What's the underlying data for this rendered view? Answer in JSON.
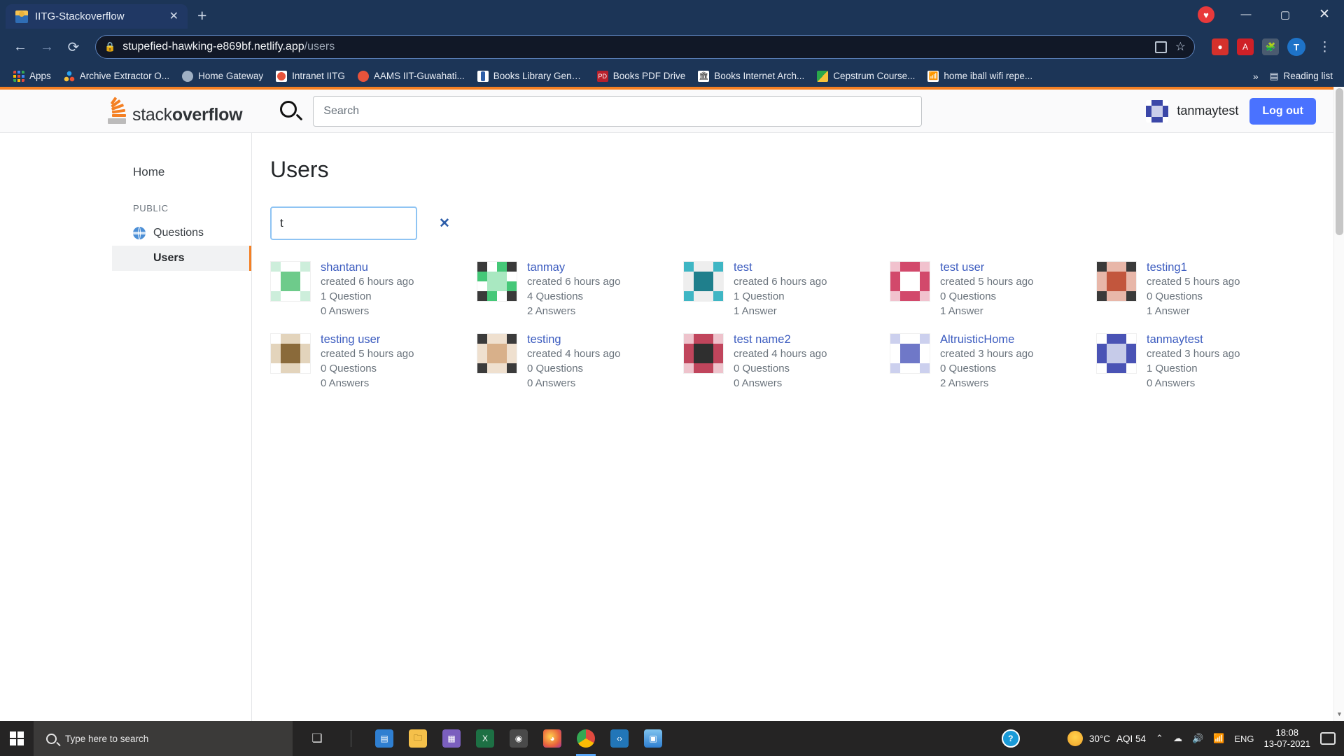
{
  "browser": {
    "tab": {
      "title": "IITG-Stackoverflow",
      "close": "✕",
      "new_tab": "+"
    },
    "window_controls": {
      "minimize": "—",
      "maximize": "▢",
      "close": "✕"
    },
    "nav": {
      "back": "←",
      "forward": "→",
      "reload": "⟳"
    },
    "omnibox": {
      "lock_icon": "lock-icon",
      "domain": "stupefied-hawking-e869bf.netlify.app",
      "path": "/users",
      "qr_icon": "qr-code-icon",
      "bookmark_icon": "star-icon"
    },
    "profile_initial": "T",
    "menu_icon": "⋮",
    "bookmarks": [
      {
        "label": "Apps",
        "icon": "apps-grid-icon"
      },
      {
        "label": "Archive Extractor O...",
        "icon": "archive-extractor-icon"
      },
      {
        "label": "Home Gateway",
        "icon": "globe-icon"
      },
      {
        "label": "Intranet IITG",
        "icon": "intranet-icon"
      },
      {
        "label": "AAMS IIT-Guwahati...",
        "icon": "aams-icon"
      },
      {
        "label": "Books Library Gene...",
        "icon": "libgen-icon"
      },
      {
        "label": "Books PDF Drive",
        "icon": "pdfdrive-icon"
      },
      {
        "label": "Books Internet Arch...",
        "icon": "archive-org-icon"
      },
      {
        "label": "Cepstrum Course...",
        "icon": "google-drive-icon"
      },
      {
        "label": "home iball wifi repe...",
        "icon": "wifi-icon"
      }
    ],
    "bookmarks_overflow": "»",
    "reading_list": "Reading list"
  },
  "app": {
    "logo": {
      "stack": "stack",
      "overflow": "overflow"
    },
    "search": {
      "placeholder": "Search",
      "icon": "search-icon"
    },
    "user": {
      "name": "tanmaytest",
      "avatar": "user-avatar"
    },
    "logout_label": "Log out",
    "accent_orange": "#f48024",
    "link_blue": "#3b5bbf",
    "logout_blue": "#4a72ff"
  },
  "sidebar": {
    "home": "Home",
    "section_label": "PUBLIC",
    "items": [
      {
        "label": "Questions",
        "icon": "globe-icon",
        "active": false
      },
      {
        "label": "Users",
        "icon": "",
        "active": true
      }
    ]
  },
  "main": {
    "title": "Users",
    "filter": {
      "value": "t",
      "placeholder": "",
      "clear_icon": "✕"
    },
    "users": [
      {
        "name": "shantanu",
        "created": "created 6 hours ago",
        "questions": "1 Question",
        "answers": "0 Answers",
        "c1": "#6ecb8b",
        "c2": "#cdeedb",
        "c3": "#3b3b3b"
      },
      {
        "name": "tanmay",
        "created": "created 6 hours ago",
        "questions": "4 Questions",
        "answers": "2 Answers",
        "c1": "#45c878",
        "c2": "#a9e8c1",
        "c3": "#333333"
      },
      {
        "name": "test",
        "created": "created 6 hours ago",
        "questions": "1 Question",
        "answers": "1 Answer",
        "c1": "#3fb6c4",
        "c2": "#bfe5ea",
        "c3": "#1f7f8c"
      },
      {
        "name": "test user",
        "created": "created 5 hours ago",
        "questions": "0 Questions",
        "answers": "1 Answer",
        "c1": "#d2496b",
        "c2": "#f1c2ce",
        "c3": "#b03355"
      },
      {
        "name": "testing1",
        "created": "created 5 hours ago",
        "questions": "0 Questions",
        "answers": "1 Answer",
        "c1": "#c2563d",
        "c2": "#e8b7a9",
        "c3": "#3a3a3a"
      },
      {
        "name": "testing user",
        "created": "created 5 hours ago",
        "questions": "0 Questions",
        "answers": "0 Answers",
        "c1": "#8a6a3a",
        "c2": "#e3d4bc",
        "c3": "#6b4f24"
      },
      {
        "name": "testing",
        "created": "created 4 hours ago",
        "questions": "0 Questions",
        "answers": "0 Answers",
        "c1": "#d8b08a",
        "c2": "#efe0cf",
        "c3": "#3b3b3b"
      },
      {
        "name": "test name2",
        "created": "created 4 hours ago",
        "questions": "0 Questions",
        "answers": "0 Answers",
        "c1": "#c0455c",
        "c2": "#eec3cc",
        "c3": "#2f2f2f"
      },
      {
        "name": "AltruisticHome",
        "created": "created 3 hours ago",
        "questions": "0 Questions",
        "answers": "2 Answers",
        "c1": "#6f78c8",
        "c2": "#ccd0ee",
        "c3": "#444b96"
      },
      {
        "name": "tanmaytest",
        "created": "created 3 hours ago",
        "questions": "1 Question",
        "answers": "0 Answers",
        "c1": "#4a53b5",
        "c2": "#c6cbe9",
        "c3": "#2a2f72"
      }
    ]
  },
  "taskbar": {
    "start_icon": "windows-logo-icon",
    "search_placeholder": "Type here to search",
    "search_icon": "magnifier-icon",
    "items": [
      {
        "name": "task-view-icon",
        "glyph": "❏"
      },
      {
        "name": "teams-icon",
        "glyph": "▤"
      },
      {
        "name": "file-explorer-icon",
        "glyph": "🗀"
      },
      {
        "name": "app-icon",
        "glyph": "▦"
      },
      {
        "name": "excel-icon",
        "glyph": "X"
      },
      {
        "name": "camera-icon",
        "glyph": "◉"
      },
      {
        "name": "firefox-icon",
        "glyph": "◕"
      },
      {
        "name": "chrome-icon",
        "glyph": "◉"
      },
      {
        "name": "vscode-icon",
        "glyph": "‹›"
      },
      {
        "name": "photos-icon",
        "glyph": "▣"
      }
    ],
    "help_icon": "?",
    "weather": {
      "temp": "30°C",
      "aqi": "AQI 54",
      "icon": "sun-cloud-icon"
    },
    "tray": {
      "chevron": "⌃",
      "onedrive": "☁",
      "speaker": "🔊",
      "network": "📶",
      "language": "ENG"
    },
    "clock": {
      "time": "18:08",
      "date": "13-07-2021"
    },
    "notification_icon": "notification-icon"
  }
}
